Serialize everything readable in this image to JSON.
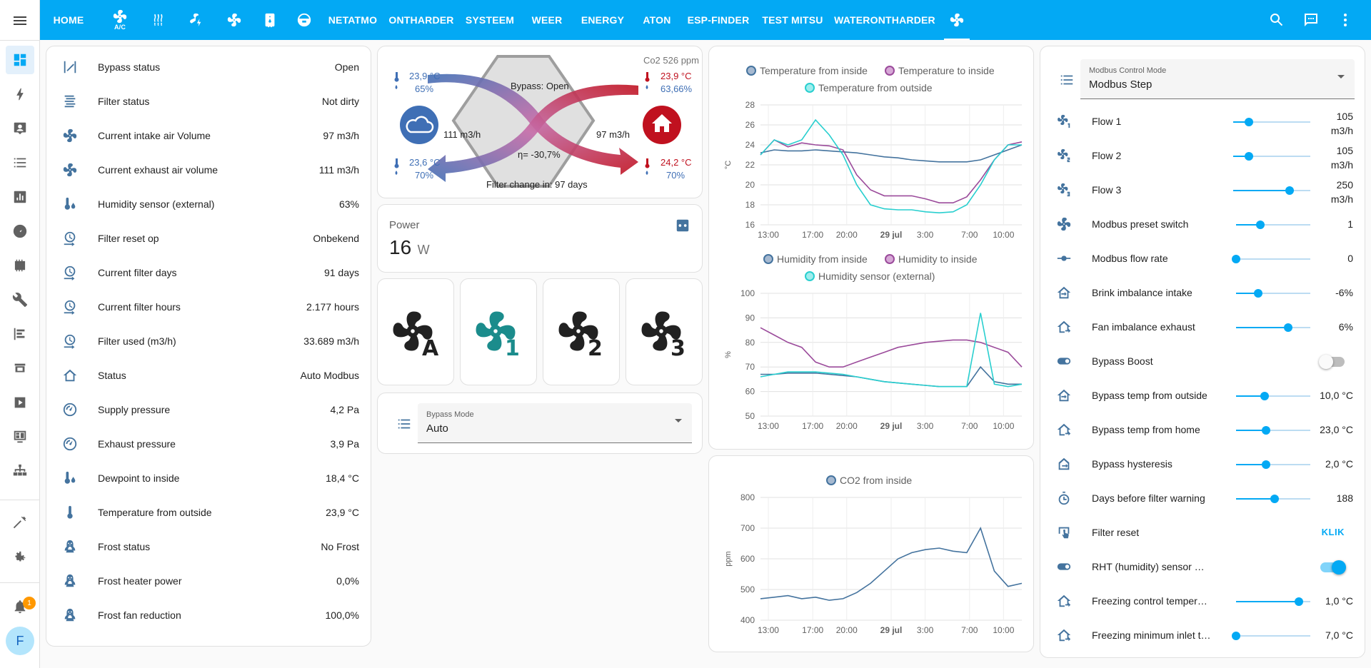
{
  "topbar": {
    "tabs": [
      "HOME",
      "A/C",
      "",
      "",
      "",
      "",
      "",
      "NETATMO",
      "ONTHARDER",
      "SYSTEEM",
      "WEER",
      "ENERGY",
      "ATON",
      "ESP-FINDER",
      "TEST MITSU",
      "WATERONTHARDER",
      ""
    ],
    "ac_sub": "A/C"
  },
  "sidebar": {
    "avatar": "F",
    "notification_count": "1"
  },
  "entities": [
    {
      "name": "Bypass status",
      "value": "Open",
      "icon": "bypass-icon"
    },
    {
      "name": "Filter status",
      "value": "Not dirty",
      "icon": "filter-icon"
    },
    {
      "name": "Current intake air Volume",
      "value": "97 m3/h",
      "icon": "fan-icon"
    },
    {
      "name": "Current exhaust air volume",
      "value": "111 m3/h",
      "icon": "fan-icon"
    },
    {
      "name": "Humidity sensor (external)",
      "value": "63%",
      "icon": "thermometer-water-icon"
    },
    {
      "name": "Filter reset op",
      "value": "Onbekend",
      "icon": "clock-arrow-icon"
    },
    {
      "name": "Current filter days",
      "value": "91 days",
      "icon": "clock-arrow-icon"
    },
    {
      "name": "Current filter hours",
      "value": "2.177 hours",
      "icon": "clock-arrow-icon"
    },
    {
      "name": "Filter used (m3/h)",
      "value": "33.689 m3/h",
      "icon": "clock-arrow-icon"
    },
    {
      "name": "Status",
      "value": "Auto Modbus",
      "icon": "home-outline-icon"
    },
    {
      "name": "Supply pressure",
      "value": "4,2 Pa",
      "icon": "gauge-icon"
    },
    {
      "name": "Exhaust pressure",
      "value": "3,9 Pa",
      "icon": "gauge-icon"
    },
    {
      "name": "Dewpoint to inside",
      "value": "18,4 °C",
      "icon": "thermometer-water-icon"
    },
    {
      "name": "Temperature from outside",
      "value": "23,9 °C",
      "icon": "thermometer-icon"
    },
    {
      "name": "Frost status",
      "value": "No Frost",
      "icon": "penguin-icon"
    },
    {
      "name": "Frost heater power",
      "value": "0,0%",
      "icon": "penguin-icon"
    },
    {
      "name": "Frost fan reduction",
      "value": "100,0%",
      "icon": "penguin-icon"
    }
  ],
  "hrv": {
    "co2": "Co2 526 ppm",
    "left_top_temp": "23,9 °C",
    "left_top_hum": "65%",
    "left_bottom_temp": "23,6 °C",
    "left_bottom_hum": "70%",
    "right_top_temp": "23,9 °C",
    "right_top_hum": "63,66%",
    "right_bottom_temp": "24,2 °C",
    "right_bottom_hum": "70%",
    "bypass": "Bypass: Open",
    "flow_left": "111 m3/h",
    "flow_right": "97 m3/h",
    "efficiency": "η= -30,7%",
    "filter_change": "Filter change in: 97 days"
  },
  "power": {
    "title": "Power",
    "value": "16",
    "unit": "W"
  },
  "fan_buttons": [
    {
      "label": "A",
      "color": "#212121"
    },
    {
      "label": "1",
      "color": "#1b8c8c"
    },
    {
      "label": "2",
      "color": "#212121"
    },
    {
      "label": "3",
      "color": "#212121"
    }
  ],
  "bypass_mode": {
    "label": "Bypass Mode",
    "value": "Auto"
  },
  "modbus_mode": {
    "label": "Modbus Control Mode",
    "value": "Modbus Step"
  },
  "controls": [
    {
      "name": "Flow 1",
      "value": "105",
      "value2": "m3/h",
      "fraction": 0.2,
      "type": "slider2",
      "icon": "fan-1-icon"
    },
    {
      "name": "Flow 2",
      "value": "105",
      "value2": "m3/h",
      "fraction": 0.2,
      "type": "slider2",
      "icon": "fan-2-icon"
    },
    {
      "name": "Flow 3",
      "value": "250",
      "value2": "m3/h",
      "fraction": 0.73,
      "type": "slider2",
      "icon": "fan-3-icon"
    },
    {
      "name": "Modbus preset switch",
      "value": "1",
      "fraction": 0.33,
      "type": "slider",
      "icon": "fan-icon"
    },
    {
      "name": "Modbus flow rate",
      "value": "0",
      "fraction": 0.0,
      "type": "slider",
      "icon": "dot-line-icon"
    },
    {
      "name": "Brink imbalance intake",
      "value": "-6%",
      "fraction": 0.3,
      "type": "slider",
      "icon": "home-import-icon"
    },
    {
      "name": "Fan imbalance exhaust",
      "value": "6%",
      "fraction": 0.7,
      "type": "slider",
      "icon": "home-export-icon"
    },
    {
      "name": "Bypass Boost",
      "value": "",
      "state": "off",
      "type": "toggle",
      "icon": "toggle-icon"
    },
    {
      "name": "Bypass temp from outside",
      "value": "10,0 °C",
      "fraction": 0.38,
      "type": "slider",
      "icon": "home-import-icon"
    },
    {
      "name": "Bypass temp from home",
      "value": "23,0 °C",
      "fraction": 0.4,
      "type": "slider",
      "icon": "home-export-icon"
    },
    {
      "name": "Bypass hysteresis",
      "value": "2,0 °C",
      "fraction": 0.4,
      "type": "slider",
      "icon": "home-arrow-icon"
    },
    {
      "name": "Days before filter warning",
      "value": "188",
      "fraction": 0.52,
      "type": "slider",
      "icon": "timer-icon"
    },
    {
      "name": "Filter reset",
      "value": "KLIK",
      "type": "button",
      "icon": "gesture-tap-icon"
    },
    {
      "name": "RHT (humidity) sensor mode",
      "value": "",
      "state": "on",
      "type": "toggle",
      "icon": "toggle-icon"
    },
    {
      "name": "Freezing control temperatu...",
      "value": "1,0 °C",
      "fraction": 0.85,
      "type": "slider",
      "icon": "home-export-icon"
    },
    {
      "name": "Freezing minimum inlet te...",
      "value": "7,0 °C",
      "fraction": 0.0,
      "type": "slider",
      "icon": "home-export-icon"
    }
  ],
  "colors": {
    "accent": "#03a9f4",
    "icon": "#44739e",
    "red": "#c0111f",
    "blue": "#3f6fb5",
    "teal": "#29cfcf",
    "purple": "#9b4b9b"
  },
  "chart_data": [
    {
      "type": "line",
      "series": [
        {
          "name": "Temperature from inside",
          "color": "#44739e",
          "values": [
            23.2,
            23.5,
            23.4,
            23.4,
            23.5,
            23.4,
            23.3,
            23.2,
            23.0,
            22.8,
            22.7,
            22.5,
            22.4,
            22.3,
            22.3,
            22.3,
            22.5,
            23.0,
            23.5,
            24.0
          ]
        },
        {
          "name": "Temperature to inside",
          "color": "#9b4b9b",
          "values": [
            23.0,
            24.5,
            23.8,
            24.2,
            24.0,
            23.9,
            23.5,
            21.0,
            19.5,
            18.9,
            18.9,
            18.9,
            18.6,
            18.2,
            18.2,
            18.8,
            20.5,
            22.5,
            24.0,
            24.3
          ]
        },
        {
          "name": "Temperature from outside",
          "color": "#29cfcf",
          "values": [
            23.0,
            24.5,
            24.0,
            24.5,
            26.5,
            25.0,
            23.0,
            20.0,
            18.0,
            17.6,
            17.5,
            17.5,
            17.3,
            17.2,
            17.3,
            18.0,
            20.0,
            22.5,
            24.0,
            24.0
          ]
        }
      ],
      "x_ticks": [
        "13:00",
        "17:00",
        "20:00",
        "29 jul",
        "3:00",
        "7:00",
        "10:00"
      ],
      "ylabel": "°C",
      "ylim": [
        16,
        28
      ],
      "y_ticks": [
        16,
        18,
        20,
        22,
        24,
        26,
        28
      ]
    },
    {
      "type": "line",
      "series": [
        {
          "name": "Humidity from inside",
          "color": "#44739e",
          "values": [
            67,
            67,
            67.5,
            67.5,
            67.5,
            67,
            66.5,
            66,
            65,
            64,
            63.5,
            63,
            62.5,
            62,
            62,
            62,
            70,
            64,
            63,
            63
          ]
        },
        {
          "name": "Humidity to inside",
          "color": "#9b4b9b",
          "values": [
            86,
            83,
            80,
            78,
            72,
            70,
            70,
            72,
            74,
            76,
            78,
            79,
            80,
            80.5,
            81,
            81,
            80,
            78,
            76,
            70
          ]
        },
        {
          "name": "Humidity sensor (external)",
          "color": "#29cfcf",
          "values": [
            66,
            67,
            68,
            68,
            68,
            67.5,
            67,
            66,
            65,
            64,
            63.5,
            63,
            62.5,
            62,
            62,
            62,
            92,
            63,
            62,
            63
          ]
        }
      ],
      "x_ticks": [
        "13:00",
        "17:00",
        "20:00",
        "29 jul",
        "3:00",
        "7:00",
        "10:00"
      ],
      "ylabel": "%",
      "ylim": [
        50,
        100
      ],
      "y_ticks": [
        50,
        60,
        70,
        80,
        90,
        100
      ]
    },
    {
      "type": "line",
      "series": [
        {
          "name": "CO2 from inside",
          "color": "#44739e",
          "values": [
            470,
            475,
            480,
            470,
            475,
            465,
            470,
            490,
            520,
            560,
            600,
            620,
            630,
            635,
            625,
            620,
            700,
            560,
            510,
            520
          ]
        }
      ],
      "x_ticks": [
        "13:00",
        "17:00",
        "20:00",
        "29 jul",
        "3:00",
        "7:00",
        "10:00"
      ],
      "ylabel": "ppm",
      "ylim": [
        400,
        800
      ],
      "y_ticks": [
        400,
        500,
        600,
        700,
        800
      ]
    }
  ]
}
